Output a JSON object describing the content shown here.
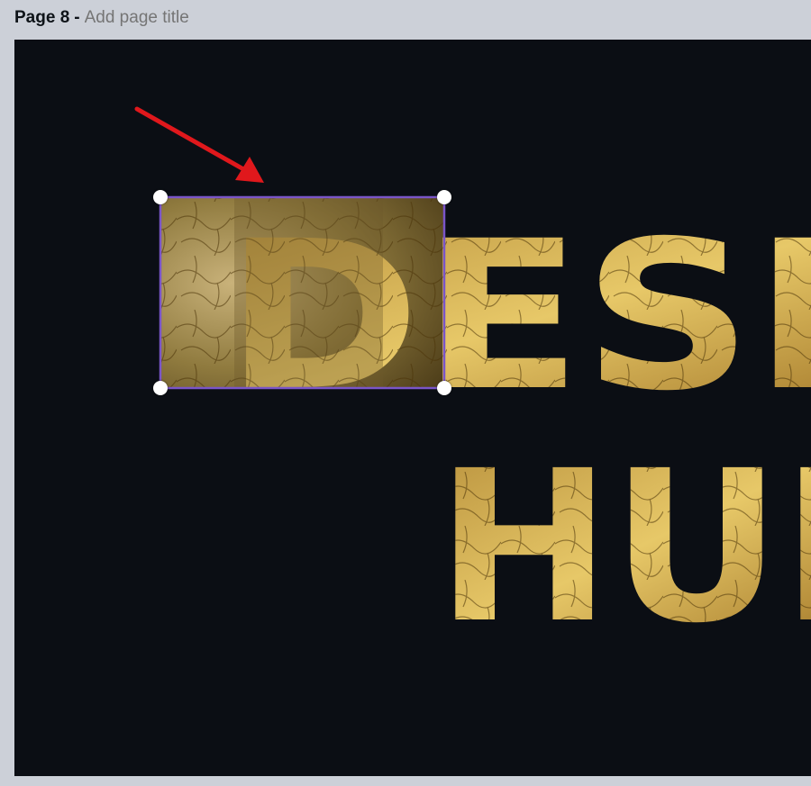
{
  "header": {
    "page_label": "Page 8",
    "separator": "-",
    "title_placeholder": "Add page title"
  },
  "canvas": {
    "background": "#0b0e14",
    "text_line_1": "DESIG",
    "text_line_2": "HUB",
    "selected_letter": "D",
    "gold_light": "#e7c868",
    "gold_mid": "#b58d3a",
    "gold_dark": "#5d4416"
  },
  "selection": {
    "border_color": "#7a55c8"
  },
  "annotation": {
    "arrow_color": "#e0181c"
  }
}
